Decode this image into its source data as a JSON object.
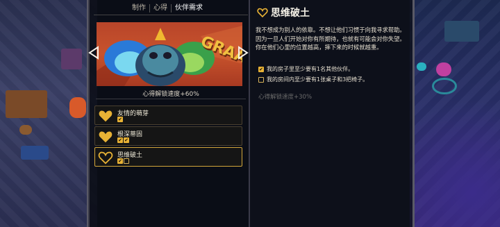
{
  "tabs": [
    {
      "label": "制作",
      "active": false
    },
    {
      "label": "心得",
      "active": false
    },
    {
      "label": "伙伴需求",
      "active": true
    }
  ],
  "banner": {
    "art_text": "GRAAL",
    "prev_icon": "triangle-left-icon",
    "next_icon": "triangle-right-icon"
  },
  "caption": "心得解锁速度+60%",
  "items": [
    {
      "title": "友情的萌芽",
      "checks": [
        true
      ],
      "selected": false
    },
    {
      "title": "根深蒂固",
      "checks": [
        true,
        true
      ],
      "selected": false
    },
    {
      "title": "思维破土",
      "checks": [
        true,
        false
      ],
      "selected": true
    }
  ],
  "detail": {
    "title": "思维破土",
    "description": "我不想成为别人的依靠。不想让他们习惯于向我寻求帮助。因为一旦人们开始对你有所期待，也就有可能会对你失望。你在他们心里的位置越高，摔下来的时候就越重。",
    "requirements": [
      {
        "text": "我的房子里至少要有1名其他伙伴。",
        "done": true
      },
      {
        "text": "我的房间内至少要有1张桌子和3把椅子。",
        "done": false
      }
    ],
    "bonus": "心得解锁速度+30%"
  },
  "colors": {
    "gold": "#e8b235",
    "banner_bg": "#c0482a",
    "panel_bg": "#0a0c14"
  }
}
